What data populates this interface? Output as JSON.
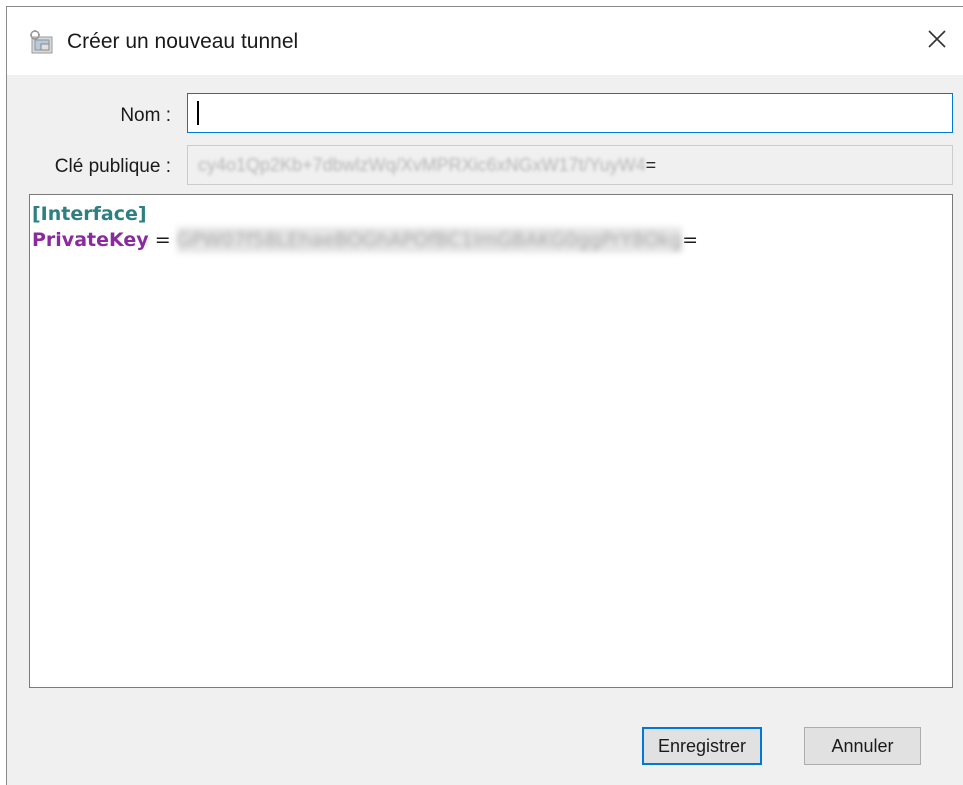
{
  "window": {
    "title": "Créer un nouveau tunnel",
    "icon": "tunnel-app-icon",
    "close_icon": "close-icon"
  },
  "form": {
    "name_label": "Nom :",
    "name_value": "",
    "public_key_label": "Clé publique :",
    "public_key_value_blurred": "cy4o1Qp2Kb+7dbwlzWq/XvMPRXic6xNGxW17t/YuyW4",
    "public_key_suffix": "="
  },
  "editor": {
    "section": "[Interface]",
    "key_name": "PrivateKey",
    "separator": " = ",
    "key_value_blurred": "GPW07f58LEhaeBOGhAPOfBC1ImGBAKG0ggPrY8Okg",
    "key_suffix": "="
  },
  "buttons": {
    "save_label": "Enregistrer",
    "cancel_label": "Annuler"
  },
  "colors": {
    "accent": "#0078d7",
    "section_color": "#2e7f82",
    "key_color": "#8b2a9e"
  }
}
